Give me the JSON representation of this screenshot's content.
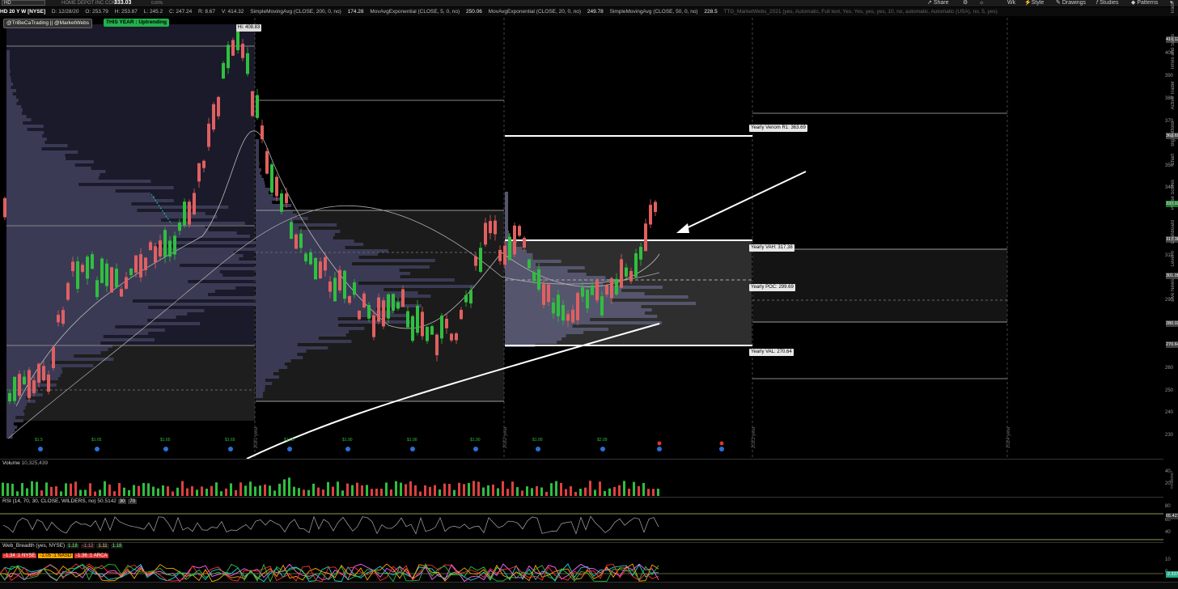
{
  "toolbar": {
    "symbol": "HD",
    "company": "HOME DEPOT INC COM",
    "last": "333.03",
    "change_pct": "0.00%",
    "buttons": [
      "Share",
      "Wk",
      "Style",
      "Drawings",
      "Studies",
      "Patterns"
    ]
  },
  "info": {
    "title": "HD 20 Y W [NYSE]",
    "date": "D: 12/28/20",
    "open": "O: 253.79",
    "high": "H: 253.87",
    "low": "L: 245.2",
    "close": "C: 247.24",
    "range": "R: 8.67",
    "value": "V: 414.32",
    "sma200": "SimpleMovingAvg (CLOSE, 200, 0, no)",
    "sma200_val": "174.28",
    "ema5": "MovAvgExponential (CLOSE, 5, 0, no)",
    "ema5_val": "250.06",
    "ema20": "MovAvgExponential (CLOSE, 20, 0, no)",
    "ema20_val": "249.78",
    "sma50": "SimpleMovingAvg (CLOSE, 50, 0, no)",
    "sma50_val": "228.5",
    "ttg": "TTG_MarketWebs_2021 (yes, Automatic, Full text, Yes, Yes, yes, yes, 10, no, automatic, Automatic (USA), no, 5, yes)"
  },
  "tags": {
    "handle": "@TriBeCaTrading || @MarketWebs",
    "trend": "THIS YEAR : Uptrending",
    "high_label": "Hi: 408.83"
  },
  "levels": {
    "venom": "Yearly Venom R1: 363.69",
    "vah": "Yearly VAH: 317.38",
    "poc": "Yearly POC: 299.69",
    "val": "Yearly VAL: 270.64"
  },
  "price_axis": {
    "ticks": [
      "414.12",
      "400",
      "390",
      "380",
      "370",
      "363.69",
      "350",
      "340",
      "333.03",
      "317.38",
      "310",
      "301.05",
      "290",
      "280.02",
      "270.64",
      "260",
      "250",
      "240",
      "230"
    ],
    "tags": [
      "414.12",
      "363.69",
      "333.03",
      "317.38",
      "301.05",
      "280.02",
      "270.64"
    ]
  },
  "year_labels": [
    "2021 year",
    "2022 year",
    "2023 year",
    "2024 year"
  ],
  "dividends": [
    "$1.5",
    "$1.65",
    "$1.65",
    "$1.65",
    "$1.65",
    "$1.90",
    "$1.90",
    "$1.90",
    "$1.90",
    "$2.09",
    "$2.09",
    "$2.09"
  ],
  "volume": {
    "title": "Volume",
    "value": "10,325,439",
    "axis": [
      "40",
      "20"
    ],
    "unit": "<millions>"
  },
  "rsi": {
    "title": "RSI (14, 70, 30, CLOSE, WILDERS, no)",
    "value": "50.5142",
    "ob": "30",
    "os": "70",
    "axis": [
      "80",
      "60",
      "40"
    ],
    "last": "65.4212"
  },
  "breadth": {
    "title": "Web_Breadth (yes, NYSE)",
    "chips": [
      "1.18",
      "-1.12",
      "1.11",
      "1.18"
    ],
    "row2": [
      "-1.34 :1 NYSE",
      "-1.05 :1 NASD",
      "-1.36 :1 ARCA"
    ],
    "axis": [
      "10",
      "0"
    ],
    "last": "-2.3377"
  },
  "side_tabs": [
    "Trade",
    "Times and Sales",
    "Active Trader",
    "Big Buttons",
    "Chart",
    "Phase Scores",
    "Dashboard",
    "Level II",
    "Live News"
  ]
}
